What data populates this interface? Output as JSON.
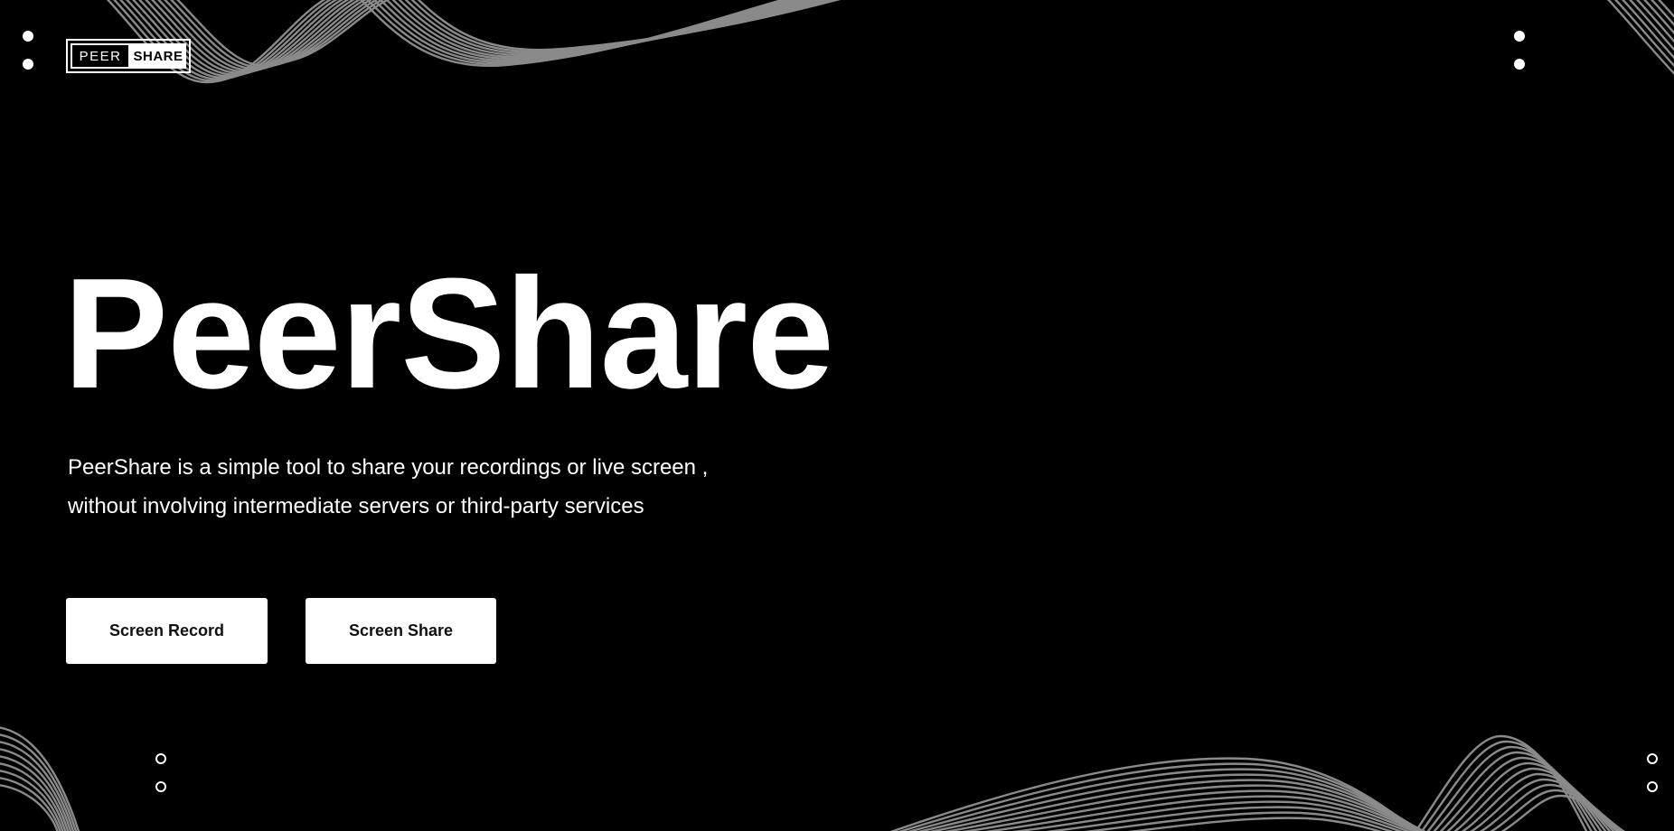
{
  "logo": {
    "left_text": "PEER",
    "right_text": "SHARE"
  },
  "hero": {
    "title": "PeerShare",
    "description_line1": "PeerShare is a simple tool to share your recordings or live screen ,",
    "description_line2": "without involving intermediate servers or third-party services"
  },
  "actions": {
    "record_label": "Screen Record",
    "share_label": "Screen Share"
  },
  "colors": {
    "background": "#000000",
    "foreground": "#ffffff",
    "wave": "#8a8a8a"
  }
}
